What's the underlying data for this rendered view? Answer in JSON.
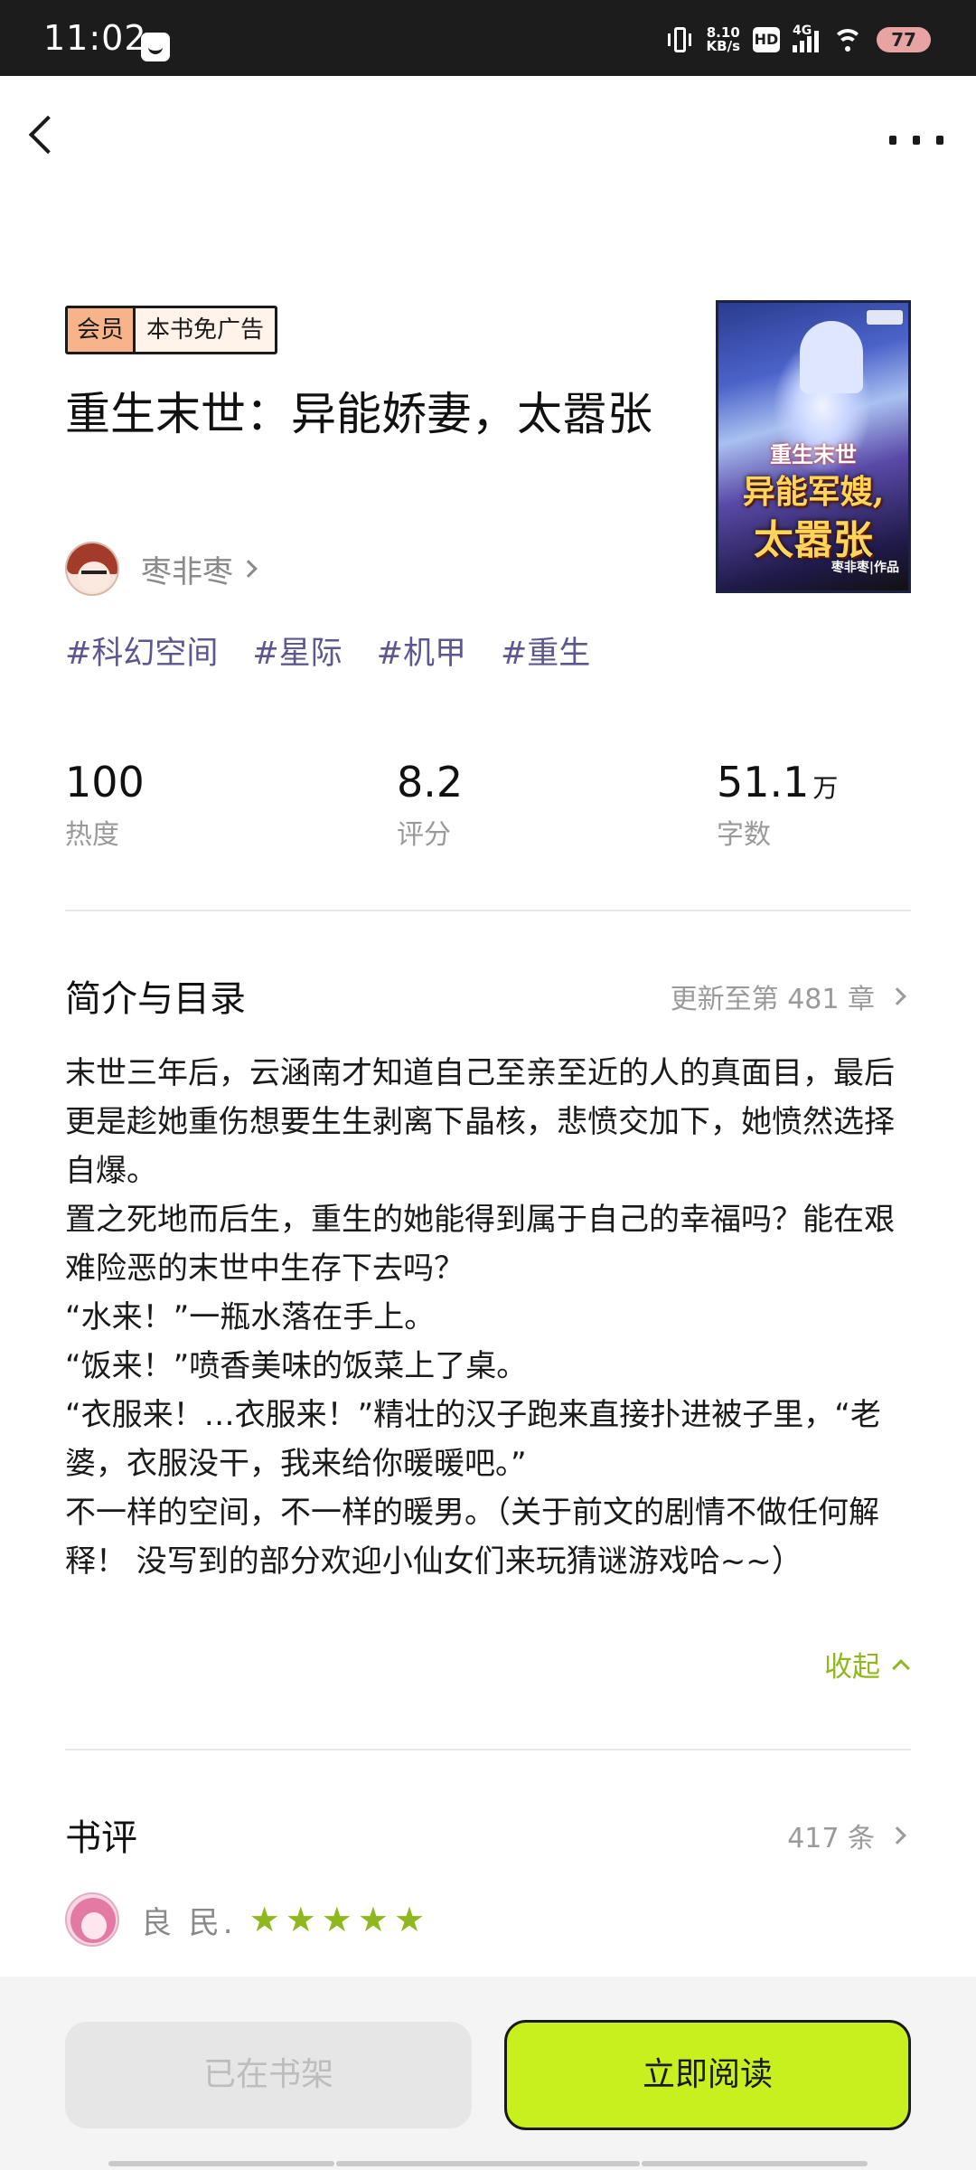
{
  "status_bar": {
    "time": "11:02",
    "net_speed_value": "8.10",
    "net_speed_unit": "KB/s",
    "hd": "HD",
    "network": "4G",
    "battery": "77"
  },
  "book": {
    "badge_vip": "会员",
    "badge_ad": "本书免广告",
    "title": "重生末世：异能娇妻，太嚣张",
    "author": "枣非枣",
    "cover": {
      "subtitle": "重生末世",
      "main_line1": "异能军嫂,",
      "main_line2": "太嚣张",
      "author_credit": "枣非枣|作品"
    },
    "genre_tags": [
      "#科幻空间",
      "#星际",
      "#机甲",
      "#重生"
    ]
  },
  "stats": [
    {
      "value": "100",
      "unit": "",
      "label": "热度"
    },
    {
      "value": "8.2",
      "unit": "",
      "label": "评分"
    },
    {
      "value": "51.1",
      "unit": "万",
      "label": "字数"
    }
  ],
  "intro": {
    "title": "简介与目录",
    "update_link": "更新至第 481 章",
    "paragraphs": [
      "末世三年后，云涵南才知道自己至亲至近的人的真面目，最后更是趁她重伤想要生生剥离下晶核，悲愤交加下，她愤然选择自爆。",
      "置之死地而后生，重生的她能得到属于自己的幸福吗？能在艰难险恶的末世中生存下去吗？",
      "“水来！”一瓶水落在手上。",
      "“饭来！”喷香美味的饭菜上了桌。",
      "“衣服来！…衣服来！”精壮的汉子跑来直接扑进被子里，“老婆，衣服没干，我来给你暖暖吧。”",
      "不一样的空间，不一样的暖男。（关于前文的剧情不做任何解释！ 没写到的部分欢迎小仙女们来玩猜谜游戏哈~~）"
    ],
    "collapse_label": "收起"
  },
  "reviews": {
    "title": "书评",
    "count_link": "417 条",
    "first_review": {
      "reviewer": "良 民.",
      "rating": 5
    }
  },
  "actions": {
    "shelf_label": "已在书架",
    "read_label": "立即阅读"
  },
  "colors": {
    "accent_green": "#c8f01e",
    "tag_purple": "#5c5790",
    "star_green": "#8fb81e"
  }
}
